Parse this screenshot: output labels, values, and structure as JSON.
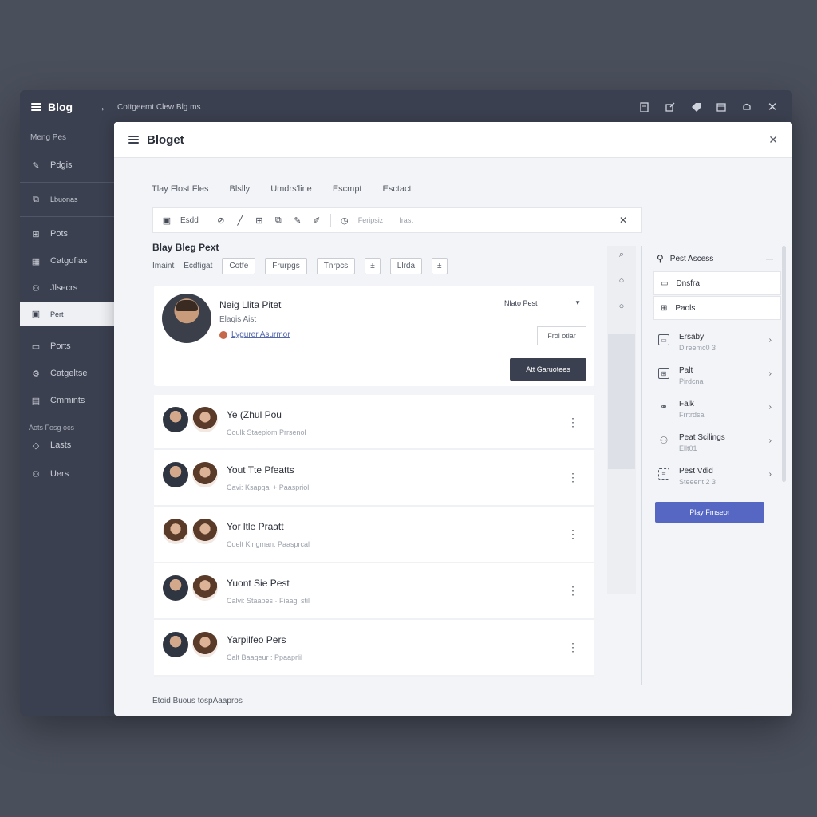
{
  "topbar": {
    "brand": "Blog",
    "breadcrumb": "Cottgeemt Clew Blg ms",
    "tool_icons": [
      "document-icon",
      "share-icon",
      "tag-icon",
      "calendar-icon",
      "bell-icon",
      "close-icon"
    ]
  },
  "sidebar": {
    "header": "Meng Pes",
    "items": [
      {
        "label": "Pdgis",
        "icon": "edit-icon"
      },
      {
        "label": "Lbuonas",
        "icon": "pages-icon"
      },
      {
        "label": "Pots",
        "icon": "posts-icon"
      },
      {
        "label": "Catgofias",
        "icon": "categories-icon"
      },
      {
        "label": "Jlsecrs",
        "icon": "users-icon"
      },
      {
        "label": "Pert",
        "icon": "image-icon",
        "active": true
      },
      {
        "label": "Ports",
        "icon": "document-icon"
      },
      {
        "label": "Catgeltse",
        "icon": "settings-icon"
      },
      {
        "label": "Cmmints",
        "icon": "comments-icon"
      }
    ],
    "section_label": "Aots Fosg ocs",
    "section_items": [
      {
        "label": "Lasts",
        "icon": "tag-icon"
      },
      {
        "label": "Uers",
        "icon": "users-icon"
      }
    ]
  },
  "panel": {
    "title": "Bloget",
    "tabs": [
      "Tlay Flost Fles",
      "Blslly",
      "Umdrs'line",
      "Escmpt",
      "Esctact"
    ],
    "toolbar": {
      "label": "Esdd",
      "faint1": "Feripsiz",
      "faint2": "Irast"
    },
    "post_title": "Blay Bleg Pext",
    "chips_row": {
      "text1": "Imaint",
      "text2": "Ecdfigat",
      "chips": [
        "Cotfe",
        "Frurpgs",
        "Tnrpcs",
        "±",
        "Llrda",
        "±"
      ]
    },
    "author": {
      "name": "Neig Llita Pitet",
      "role": "Elaqis Aist",
      "link": "Lygurer Asurmor",
      "select_value": "Nlato Pest",
      "secondary_button": "Frol otlar",
      "primary_button": "Att Garuotees"
    },
    "posts": [
      {
        "title": "Ye (Zhul Pou",
        "meta": "Coulk Staepiom  Prrsenol"
      },
      {
        "title": "Yout Tte Pfeatts",
        "meta": "Cavi: Ksapgaj + Paaspriol"
      },
      {
        "title": "Yor ltle Praatt",
        "meta": "Cdelt Kingman: Paasprcal"
      },
      {
        "title": "Yuont Sie Pest",
        "meta": "Calvi: Staapes  ·  Fiaagi stil"
      },
      {
        "title": "Yarpilfeo Pers",
        "meta": "Calt Baageur : Ppaaprlil"
      }
    ],
    "right": {
      "header": "Pest Ascess",
      "boxes": [
        "Dnsfra",
        "Paols"
      ],
      "items": [
        {
          "title": "Ersaby",
          "sub": "Direemc0 3"
        },
        {
          "title": "Palt",
          "sub": "Pirdcna"
        },
        {
          "title": "Falk",
          "sub": "Frrtrdsa"
        },
        {
          "title": "Peat Scilings",
          "sub": "Ellt01"
        },
        {
          "title": "Pest Vdid",
          "sub": "Steeent 2 3"
        }
      ],
      "button": "Play Fmseor"
    },
    "footer": "Etoid Buous tospAaapros"
  }
}
